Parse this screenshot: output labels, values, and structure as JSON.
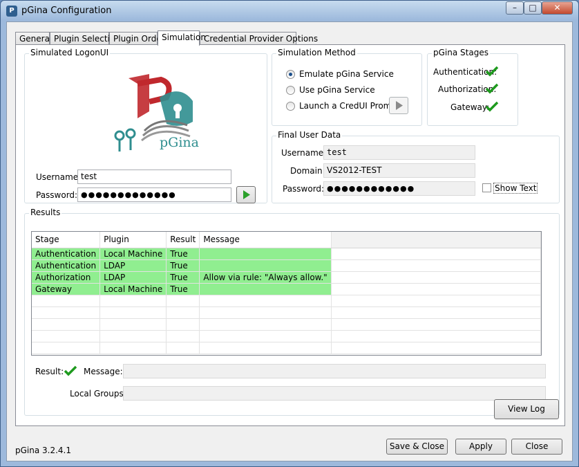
{
  "window": {
    "title": "pGina Configuration",
    "app_icon_text": "P",
    "controls": {
      "minimize": "–",
      "maximize": "□",
      "close": "✕"
    }
  },
  "tabs": [
    {
      "label": "General"
    },
    {
      "label": "Plugin Selection"
    },
    {
      "label": "Plugin Order"
    },
    {
      "label": "Simulation",
      "active": true
    },
    {
      "label": "Credential Provider Options"
    }
  ],
  "logon": {
    "title": "Simulated LogonUI",
    "logo_text": "pGina",
    "username_label": "Username:",
    "username_value": "test",
    "password_label": "Password:",
    "password_value": "●●●●●●●●●●●●●",
    "go_icon": "play-icon"
  },
  "method": {
    "title": "Simulation Method",
    "options": [
      {
        "label": "Emulate pGina Service",
        "checked": true
      },
      {
        "label": "Use pGina Service",
        "checked": false
      },
      {
        "label": "Launch a CredUI Prompt",
        "checked": false
      }
    ],
    "credui_icon": "play-icon"
  },
  "stages": {
    "title": "pGina Stages",
    "items": [
      {
        "label": "Authentication:",
        "icon": "check-icon"
      },
      {
        "label": "Authorization:",
        "icon": "check-icon"
      },
      {
        "label": "Gateway:",
        "icon": "check-icon"
      }
    ]
  },
  "final": {
    "title": "Final User Data",
    "username_label": "Username:",
    "username_value": "test",
    "domain_label": "Domain:",
    "domain_value": "VS2012-TEST",
    "password_label": "Password:",
    "password_value": "●●●●●●●●●●●●",
    "show_text_label": "Show Text"
  },
  "results": {
    "title": "Results",
    "columns": [
      "Stage",
      "Plugin",
      "Result",
      "Message"
    ],
    "rows": [
      {
        "stage": "Authentication",
        "plugin": "Local Machine",
        "result": "True",
        "message": ""
      },
      {
        "stage": "Authentication",
        "plugin": "LDAP",
        "result": "True",
        "message": ""
      },
      {
        "stage": "Authorization",
        "plugin": "LDAP",
        "result": "True",
        "message": "Allow via rule: \"Always allow.\""
      },
      {
        "stage": "Gateway",
        "plugin": "Local Machine",
        "result": "True",
        "message": ""
      }
    ],
    "result_label": "Result:",
    "result_icon": "check-icon",
    "message_label": "Message:",
    "message_value": "",
    "groups_label": "Local Groups:",
    "groups_value": ""
  },
  "buttons": {
    "view_log": "View Log",
    "save_close": "Save & Close",
    "apply": "Apply",
    "close": "Close"
  },
  "version": "pGina 3.2.4.1",
  "colors": {
    "success_row": "#90ee90",
    "check": "#1e9a1e",
    "go_arrow": "#2aa02a"
  }
}
